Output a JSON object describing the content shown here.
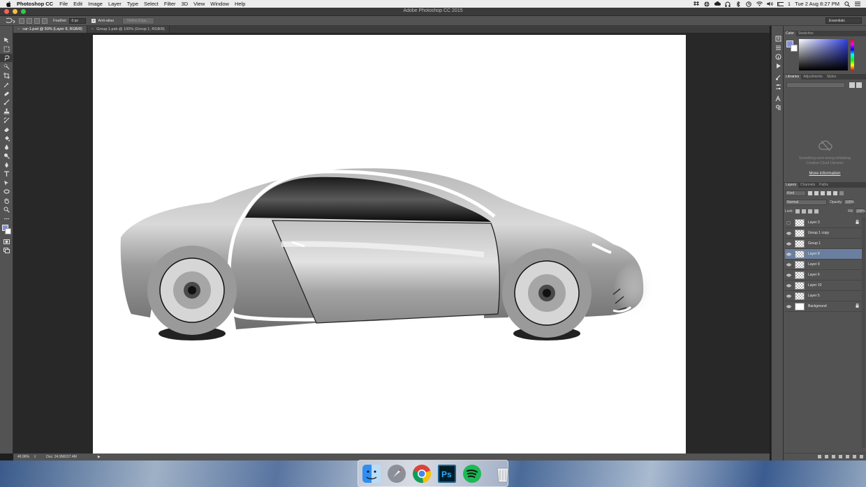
{
  "menubar": {
    "app_name": "Photoshop CC",
    "items": [
      "File",
      "Edit",
      "Image",
      "Layer",
      "Type",
      "Select",
      "Filter",
      "3D",
      "View",
      "Window",
      "Help"
    ],
    "battery": "1",
    "datetime": "Tue 2 Aug  8:27 PM"
  },
  "window": {
    "title": "Adobe Photoshop CC 2015"
  },
  "options": {
    "feather_label": "Feather:",
    "feather_value": "0 px",
    "antialias_label": "Anti-alias",
    "refine_label": "Refine Edge...",
    "workspace": "Essentials"
  },
  "tabs": [
    {
      "label": "car-1.psd @ 50% (Layer 8, RGB/8)",
      "close": "×"
    },
    {
      "label": "Group 1.psb @ 100% (Group 1, RGB/8)",
      "close": "×"
    }
  ],
  "status": {
    "zoom": "49.96%",
    "doc": "Doc: 24.9M/107.4M"
  },
  "color_panel": {
    "tabs": [
      "Color",
      "Swatches"
    ],
    "foreground": "#8090e0",
    "background": "#ffffff"
  },
  "libraries_panel": {
    "tabs": [
      "Libraries",
      "Adjustments",
      "Styles"
    ],
    "message_line1": "Something went wrong initializing",
    "message_line2": "Creative Cloud Libraries",
    "more_link": "More information"
  },
  "layers_panel": {
    "tabs": [
      "Layers",
      "Channels",
      "Paths"
    ],
    "kind": "Kind",
    "blend_mode": "Normal",
    "opacity_label": "Opacity:",
    "opacity_value": "100%",
    "lock_label": "Lock:",
    "fill_label": "Fill:",
    "fill_value": "100%",
    "layers": [
      {
        "name": "Layer 3"
      },
      {
        "name": "Group 1 copy"
      },
      {
        "name": "Group 1"
      },
      {
        "name": "Layer 8"
      },
      {
        "name": "Layer 9"
      },
      {
        "name": "Layer 6"
      },
      {
        "name": "Layer 10"
      },
      {
        "name": "Layer 5"
      },
      {
        "name": "Background"
      }
    ]
  }
}
